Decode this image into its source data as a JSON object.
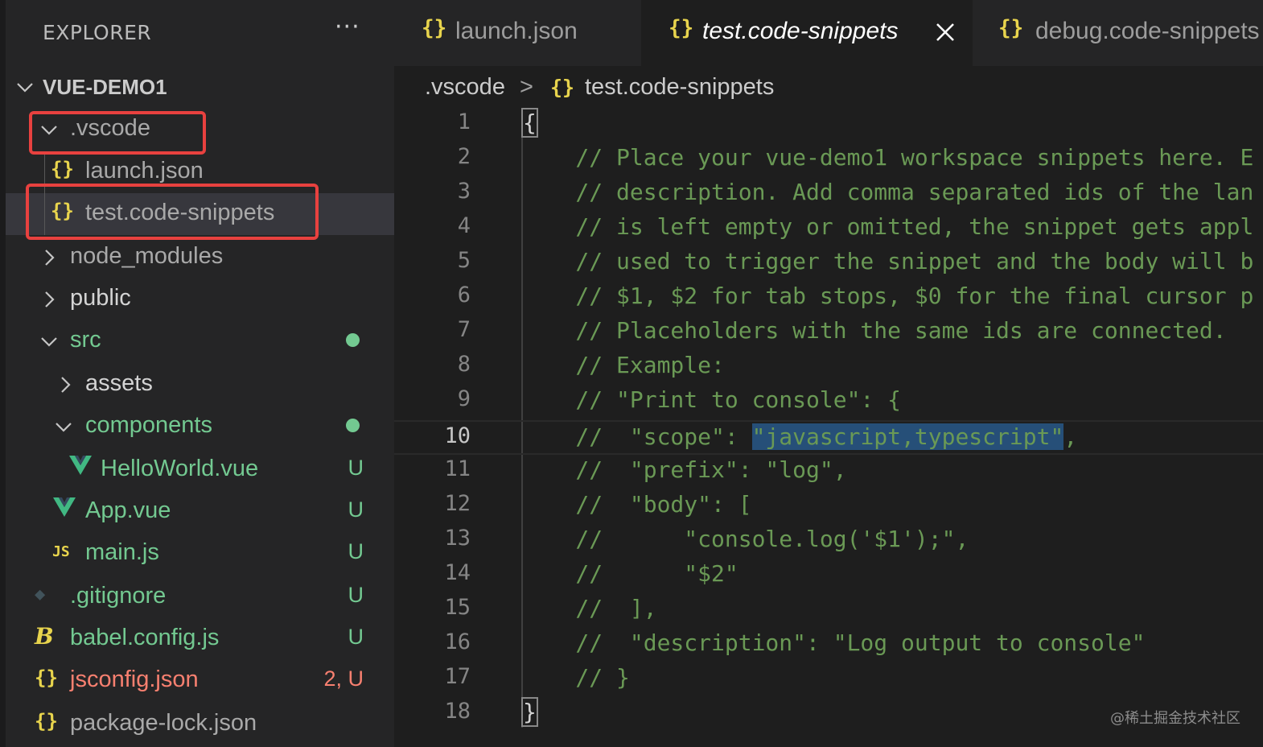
{
  "sidebar": {
    "title": "EXPLORER",
    "more": "···",
    "root": "VUE-DEMO1",
    "items": [
      {
        "label": ".vscode",
        "icon": "",
        "badge": ""
      },
      {
        "label": "launch.json",
        "icon": "{}",
        "badge": ""
      },
      {
        "label": "test.code-snippets",
        "icon": "{}",
        "badge": ""
      },
      {
        "label": "node_modules",
        "icon": "",
        "badge": ""
      },
      {
        "label": "public",
        "icon": "",
        "badge": ""
      },
      {
        "label": "src",
        "icon": "",
        "badge": ""
      },
      {
        "label": "assets",
        "icon": "",
        "badge": ""
      },
      {
        "label": "components",
        "icon": "",
        "badge": ""
      },
      {
        "label": "HelloWorld.vue",
        "icon": "V",
        "badge": "U"
      },
      {
        "label": "App.vue",
        "icon": "V",
        "badge": "U"
      },
      {
        "label": "main.js",
        "icon": "JS",
        "badge": "U"
      },
      {
        "label": ".gitignore",
        "icon": "◆",
        "badge": "U"
      },
      {
        "label": "babel.config.js",
        "icon": "B",
        "badge": "U"
      },
      {
        "label": "jsconfig.json",
        "icon": "{}",
        "badge": "2, U"
      },
      {
        "label": "package-lock.json",
        "icon": "{}",
        "badge": ""
      }
    ]
  },
  "tabs": [
    {
      "label": "launch.json",
      "icon": "{}"
    },
    {
      "label": "test.code-snippets",
      "icon": "{}"
    },
    {
      "label": "debug.code-snippets",
      "icon": "{}"
    }
  ],
  "breadcrumb": {
    "folder": ".vscode",
    "separator": ">",
    "file_icon": "{}",
    "file": "test.code-snippets"
  },
  "editor": {
    "current_line": 10,
    "lines": [
      {
        "n": "1",
        "text": "{"
      },
      {
        "n": "2",
        "text": "    // Place your vue-demo1 workspace snippets here. E"
      },
      {
        "n": "3",
        "text": "    // description. Add comma separated ids of the lan"
      },
      {
        "n": "4",
        "text": "    // is left empty or omitted, the snippet gets appl"
      },
      {
        "n": "5",
        "text": "    // used to trigger the snippet and the body will b"
      },
      {
        "n": "6",
        "text": "    // $1, $2 for tab stops, $0 for the final cursor p"
      },
      {
        "n": "7",
        "text": "    // Placeholders with the same ids are connected."
      },
      {
        "n": "8",
        "text": "    // Example:"
      },
      {
        "n": "9",
        "text": "    // \"Print to console\": {"
      },
      {
        "n": "10",
        "text_before": "    //  \"scope\": ",
        "text_selected": "\"javascript,typescript\"",
        "text_after": ","
      },
      {
        "n": "11",
        "text": "    //  \"prefix\": \"log\","
      },
      {
        "n": "12",
        "text": "    //  \"body\": ["
      },
      {
        "n": "13",
        "text": "    //      \"console.log('$1');\","
      },
      {
        "n": "14",
        "text": "    //      \"$2\""
      },
      {
        "n": "15",
        "text": "    //  ],"
      },
      {
        "n": "16",
        "text": "    //  \"description\": \"Log output to console\""
      },
      {
        "n": "17",
        "text": "    // }"
      },
      {
        "n": "18",
        "text": "}"
      }
    ]
  },
  "watermark": "@稀土掘金技术社区",
  "colors": {
    "comment": "#6a9955",
    "untracked": "#73c991",
    "error": "#f88070",
    "json_icon": "#e8d44d",
    "highlight_box": "#e8413f"
  }
}
